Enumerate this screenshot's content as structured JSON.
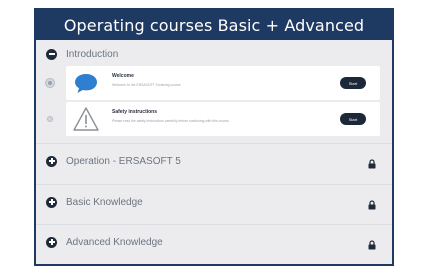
{
  "banner": {
    "title": "Operating courses Basic + Advanced"
  },
  "topics": [
    {
      "label": "Introduction",
      "expanded": true,
      "locked": false
    },
    {
      "label": "Operation - ERSASOFT 5",
      "expanded": false,
      "locked": true
    },
    {
      "label": "Basic Knowledge",
      "expanded": false,
      "locked": true
    },
    {
      "label": "Advanced Knowledge",
      "expanded": false,
      "locked": true
    }
  ],
  "lessons": [
    {
      "title": "Welcome",
      "description": "Welcome to the ERSASOFT 5 training course",
      "button": "Start",
      "icon": "speech-bubble-icon"
    },
    {
      "title": "Safety instructions",
      "description": "Please read the safety instructions carefully before continuing with this course.",
      "button": "Start",
      "icon": "warning-triangle-icon"
    }
  ],
  "colors": {
    "brand_navy": "#1e3a63",
    "background": "#ececef",
    "button_dark": "#1c2838",
    "chat_blue": "#2f7fd1"
  }
}
